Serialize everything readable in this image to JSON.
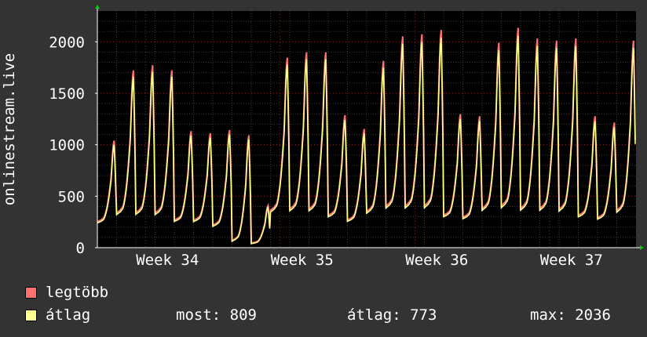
{
  "chart_data": {
    "type": "line",
    "ylabel": "onlinestream.live",
    "yticks": [
      0,
      500,
      1000,
      1500,
      2000
    ],
    "ylim": [
      0,
      2300
    ],
    "xticks": [
      "Week 34",
      "Week 35",
      "Week 36",
      "Week 37"
    ],
    "grid": true,
    "colors": {
      "background": "#333333",
      "plot": "#000000",
      "grid_major": "#8a2a2a",
      "grid_minor": "#3a3a3a",
      "max_series": "#ff7070",
      "avg_series": "#ffff90"
    },
    "days": [
      {
        "peak": 1000,
        "trough": 200
      },
      {
        "peak": 1660,
        "trough": 250
      },
      {
        "peak": 1710,
        "trough": 250
      },
      {
        "peak": 1660,
        "trough": 250
      },
      {
        "peak": 1090,
        "trough": 210
      },
      {
        "peak": 1070,
        "trough": 210
      },
      {
        "peak": 1100,
        "trough": 160
      },
      {
        "peak": 1050,
        "trough": 10
      },
      {
        "peak": 390,
        "trough": 20
      },
      {
        "peak": 1780,
        "trough": 270
      },
      {
        "peak": 1830,
        "trough": 280
      },
      {
        "peak": 1830,
        "trough": 280
      },
      {
        "peak": 1240,
        "trough": 250
      },
      {
        "peak": 1110,
        "trough": 210
      },
      {
        "peak": 1750,
        "trough": 260
      },
      {
        "peak": 1980,
        "trough": 300
      },
      {
        "peak": 2000,
        "trough": 300
      },
      {
        "peak": 2040,
        "trough": 300
      },
      {
        "peak": 1250,
        "trough": 250
      },
      {
        "peak": 1230,
        "trough": 230
      },
      {
        "peak": 1920,
        "trough": 280
      },
      {
        "peak": 2060,
        "trough": 300
      },
      {
        "peak": 1960,
        "trough": 280
      },
      {
        "peak": 1940,
        "trough": 280
      },
      {
        "peak": 1960,
        "trough": 270
      },
      {
        "peak": 1230,
        "trough": 250
      },
      {
        "peak": 1170,
        "trough": 230
      },
      {
        "peak": 1940,
        "trough": 260
      }
    ],
    "series": [
      {
        "name": "legtöbb",
        "color": "#ff7070"
      },
      {
        "name": "átlag",
        "color": "#ffff90"
      }
    ]
  },
  "legend": {
    "max_label": "legtöbb",
    "avg_label": "átlag",
    "now_label": "most: 809",
    "avg_stat_label": "átlag: 773",
    "max_stat_label": "max: 2036"
  }
}
